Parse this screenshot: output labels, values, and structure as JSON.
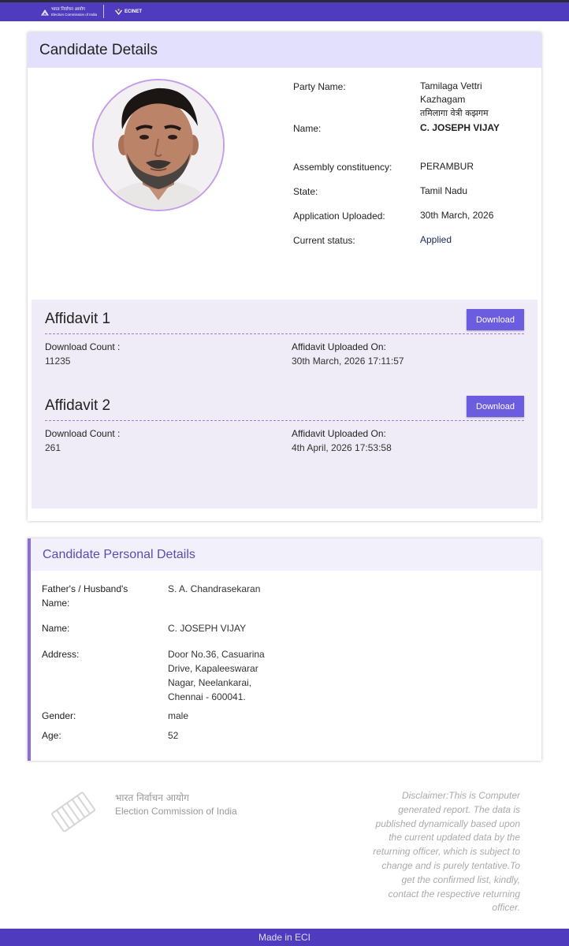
{
  "header": {
    "eci_hindi": "भारत निर्वाचन आयोग",
    "eci_english": "Election Commission of India",
    "ecinet": "ECINET",
    "bar_color": "#4f3bbd"
  },
  "candidate": {
    "title": "Candidate Details",
    "fields": {
      "party_label": "Party Name:",
      "party_value_1": "Tamilaga Vettri",
      "party_value_2": "Kazhagam",
      "party_value_hindi": "तमिलागा वेत्री कझगम",
      "name_label": "Name:",
      "name_value": "C. JOSEPH VIJAY",
      "constituency_label": "Assembly constituency:",
      "constituency_value": "PERAMBUR",
      "state_label": "State:",
      "state_value": "Tamil Nadu",
      "uploaded_label": "Application Uploaded:",
      "uploaded_value": "30th March, 2026",
      "status_label": "Current status:",
      "status_value": "Applied"
    }
  },
  "affidavits": [
    {
      "title": "Affidavit 1",
      "download_label": "Download",
      "count_label": "Download Count :",
      "count_value": "11235",
      "uploaded_label": "Affidavit Uploaded On:",
      "uploaded_value": "30th March, 2026 17:11:57"
    },
    {
      "title": "Affidavit 2",
      "download_label": "Download",
      "count_label": "Download Count :",
      "count_value": "261",
      "uploaded_label": "Affidavit Uploaded On:",
      "uploaded_value": "4th April, 2026 17:53:58"
    }
  ],
  "personal": {
    "title": "Candidate Personal Details",
    "father_label_1": "Father's / Husband's",
    "father_label_2": "Name:",
    "father_value": "S. A. Chandrasekaran",
    "name_label": "Name:",
    "name_value": "C. JOSEPH VIJAY",
    "address_label": "Address:",
    "address_lines": [
      "Door No.36, Casuarina",
      "Drive, Kapaleeswarar",
      "Nagar, Neelankarai,",
      "Chennai - 600041."
    ],
    "gender_label": "Gender:",
    "gender_value": "male",
    "age_label": "Age:",
    "age_value": "52"
  },
  "footer": {
    "eci_hindi": "भारत निर्वाचन आयोग",
    "eci_english": "Election Commission of India",
    "disclaimer": "Disclaimer:This is Computer generated report. The data is published dynamically based upon the current updated data by the returning officer, which is subject to change and is purely tentative.To get the confirmed list, kindly, contact the respective returning officer.",
    "made_in": "Made in ECI"
  }
}
